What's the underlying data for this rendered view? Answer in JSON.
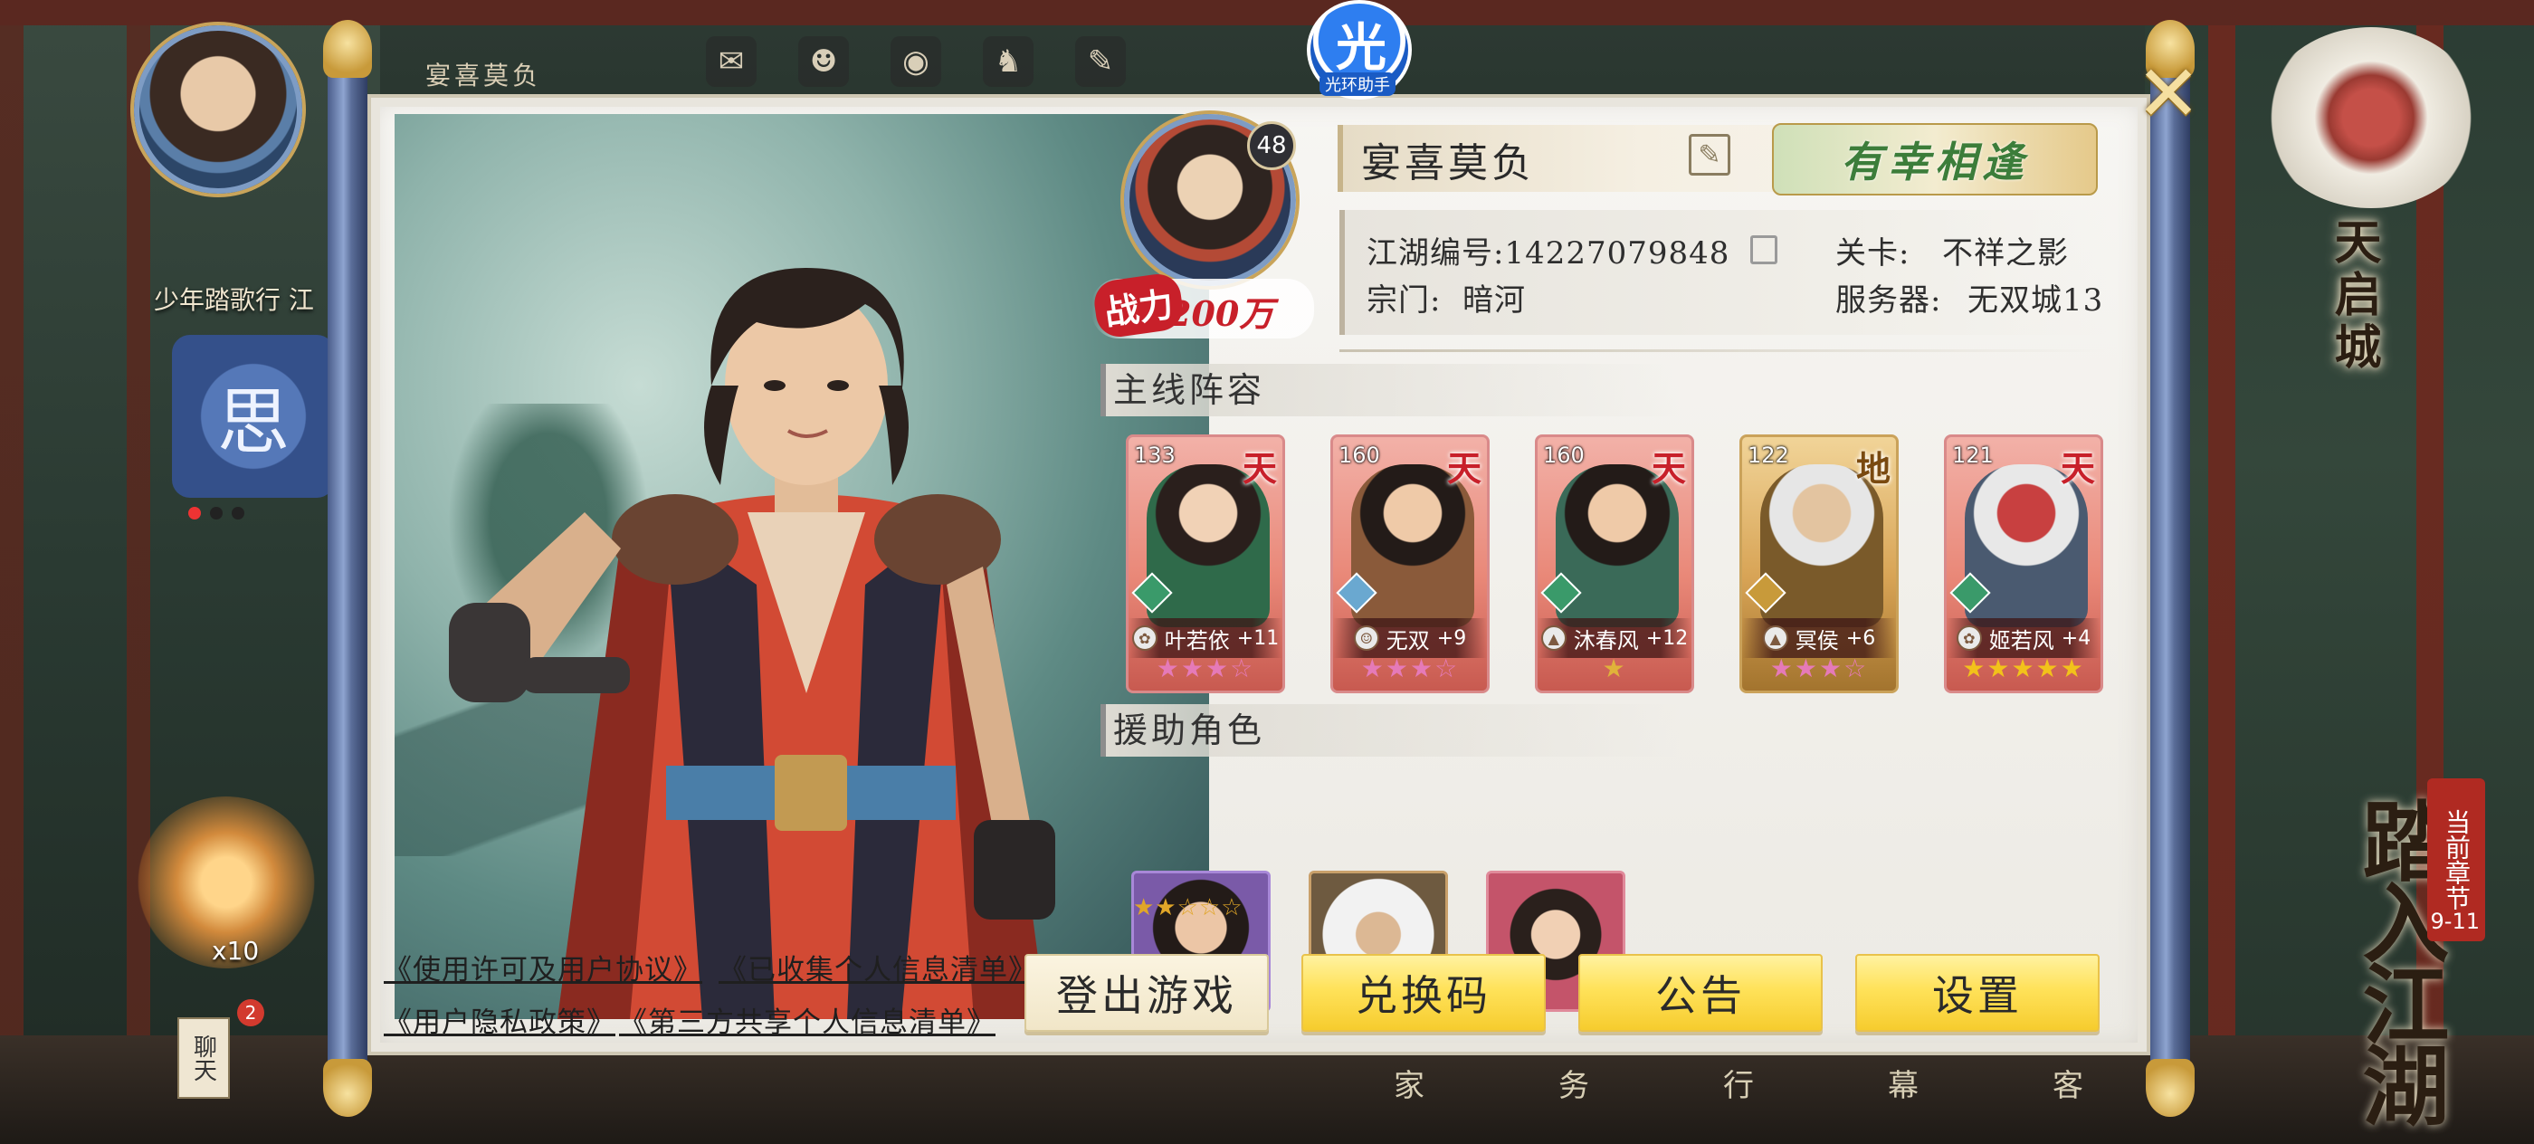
{
  "background": {
    "player_name": "宴喜莫负",
    "event_title": "少年踏歌行  江",
    "event_banner_glyph": "思",
    "hud_icons": [
      "✉",
      "☻",
      "◉",
      "♞",
      "✎"
    ],
    "card_count": "x10",
    "chat_label": "聊天",
    "chat_badge": "2",
    "right_title": "天启城",
    "chapter_tag": "当前章节",
    "chapter_number": "9-11",
    "chapter_big": "踏入江湖",
    "bottom_nav": [
      "家",
      "务",
      "行",
      "幕",
      "客"
    ]
  },
  "assistant": {
    "glyph": "光",
    "label": "光环助手"
  },
  "profile": {
    "level": "48",
    "power_label": "战力",
    "power_value": "200万",
    "name": "宴喜莫负",
    "title_tag": "有幸相逢",
    "id_label": "江湖编号:14227079848",
    "sect_label": "宗门:",
    "sect_value": "暗河",
    "stage_label": "关卡:",
    "stage_value": "不祥之影",
    "server_label": "服务器:",
    "server_value": "无双城13"
  },
  "main_lineup": {
    "title": "主线阵容",
    "heroes": [
      {
        "level": "133",
        "rank": "天",
        "name": "叶若依",
        "plus": "+11",
        "stars": "★★★☆",
        "faction": "✿"
      },
      {
        "level": "160",
        "rank": "天",
        "name": "无双",
        "plus": "+9",
        "stars": "★★★☆",
        "faction": "☺"
      },
      {
        "level": "160",
        "rank": "天",
        "name": "沐春风",
        "plus": "+12",
        "stars": "★",
        "faction": "▲"
      },
      {
        "level": "122",
        "rank": "地",
        "name": "冥侯",
        "plus": "+6",
        "stars": "★★★☆",
        "faction": "▲"
      },
      {
        "level": "121",
        "rank": "天",
        "name": "姬若风",
        "plus": "+4",
        "stars": "★★★★★",
        "faction": "✿"
      }
    ]
  },
  "support": {
    "title": "援助角色",
    "stars": "★★☆☆☆"
  },
  "links": {
    "license": "《使用许可及用户协议》",
    "collected_info": "《已收集个人信息清单》",
    "privacy": "《用户隐私政策》",
    "third_party": "《第三方共享个人信息清单》"
  },
  "buttons": {
    "logout": "登出游戏",
    "redeem": "兑换码",
    "notice": "公告",
    "settings": "设置",
    "close": "✕"
  },
  "colors": {
    "accent_yellow": "#ffe25a",
    "power_red": "#c8202a",
    "title_green": "#3c7d3a",
    "heaven_card": "#e98878",
    "earth_card": "#d8a456"
  }
}
